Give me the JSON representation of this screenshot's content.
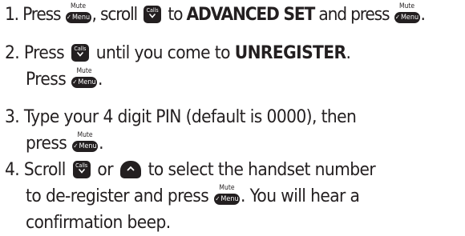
{
  "keys": {
    "mute_label": "Mute",
    "menu_label": "Menu",
    "calls_label": "Calls"
  },
  "steps": [
    {
      "num": "1.",
      "a": " Press ",
      "b": ", scroll ",
      "c": " to ",
      "bold": "ADVANCED SET",
      "d": " and press ",
      "e": "."
    },
    {
      "num": "2.",
      "a": " Press ",
      "b": " until you come to ",
      "bold": "UNREGISTER",
      "c": ".",
      "line2_a": "Press ",
      "line2_b": "."
    },
    {
      "num": "3.",
      "a": " Type your 4 digit PIN (default is 0000), then",
      "line2_a": "press ",
      "line2_b": "."
    },
    {
      "num": "4.",
      "a": " Scroll ",
      "b": " or ",
      "c": " to select the handset number",
      "line2_a": "to de-register and press ",
      "line2_b": ". You will hear a",
      "line3": "confirmation beep."
    }
  ]
}
